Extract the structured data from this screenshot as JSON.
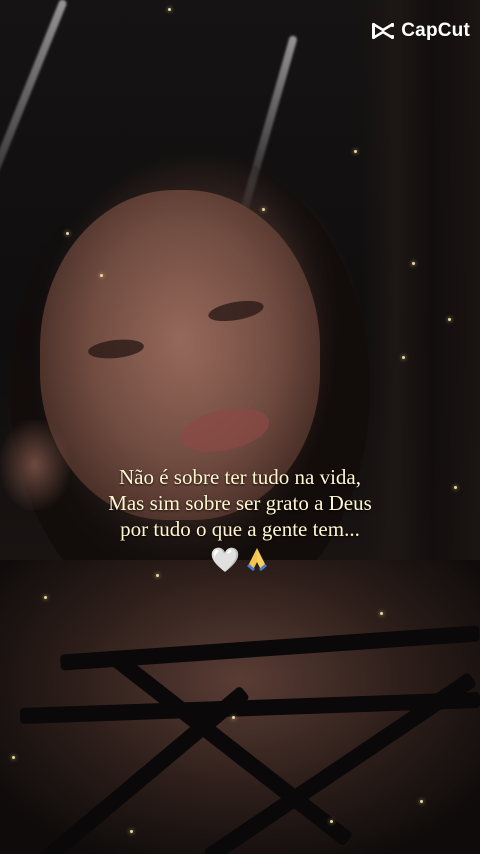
{
  "watermark": {
    "brand": "CapCut",
    "icon": "capcut-logo-icon"
  },
  "caption": {
    "line1": "Não é sobre ter tudo na vida,",
    "line2": "Mas sim sobre ser grato a Deus",
    "line3": "por tudo o que a gente tem..."
  },
  "emojis": {
    "heart": "🤍",
    "pray_icon": "praying-hands-icon"
  },
  "colors": {
    "caption_text": "#fff6cf",
    "sparkle": "#e8d79a",
    "watermark_text": "#ffffff"
  }
}
